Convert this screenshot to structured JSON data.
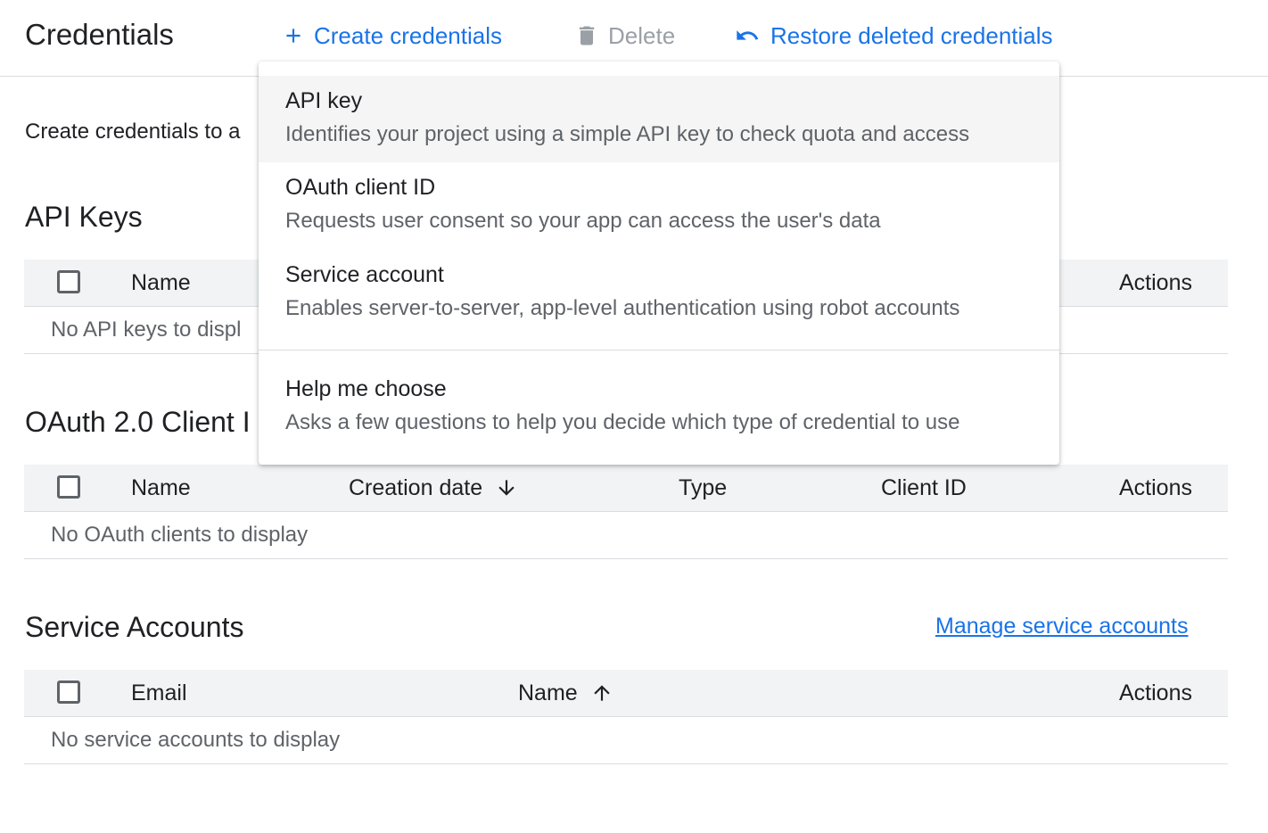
{
  "header": {
    "title": "Credentials",
    "create_label": "Create credentials",
    "delete_label": "Delete",
    "restore_label": "Restore deleted credentials"
  },
  "intro_text": "Create credentials to a",
  "api_keys": {
    "title": "API Keys",
    "columns": [
      "Name",
      "Actions"
    ],
    "empty": "No API keys to displ"
  },
  "oauth": {
    "title": "OAuth 2.0 Client I",
    "columns": [
      "Name",
      "Creation date",
      "Type",
      "Client ID",
      "Actions"
    ],
    "empty": "No OAuth clients to display"
  },
  "service_accounts": {
    "title": "Service Accounts",
    "manage_link": "Manage service accounts",
    "columns": [
      "Email",
      "Name",
      "Actions"
    ],
    "empty": "No service accounts to display"
  },
  "menu": {
    "items": [
      {
        "title": "API key",
        "description": "Identifies your project using a simple API key to check quota and access"
      },
      {
        "title": "OAuth client ID",
        "description": "Requests user consent so your app can access the user's data"
      },
      {
        "title": "Service account",
        "description": "Enables server-to-server, app-level authentication using robot accounts"
      },
      {
        "title": "Help me choose",
        "description": "Asks a few questions to help you decide which type of credential to use"
      }
    ]
  },
  "colors": {
    "accent": "#1a73e8",
    "disabled": "#9aa0a6",
    "table_header_bg": "#f1f3f4",
    "menu_hover_bg": "#f5f5f5"
  },
  "icons": {
    "create": "plus-icon",
    "delete": "trash-icon",
    "restore": "undo-icon",
    "sort_desc": "arrow-down-icon",
    "sort_asc": "arrow-up-icon"
  }
}
